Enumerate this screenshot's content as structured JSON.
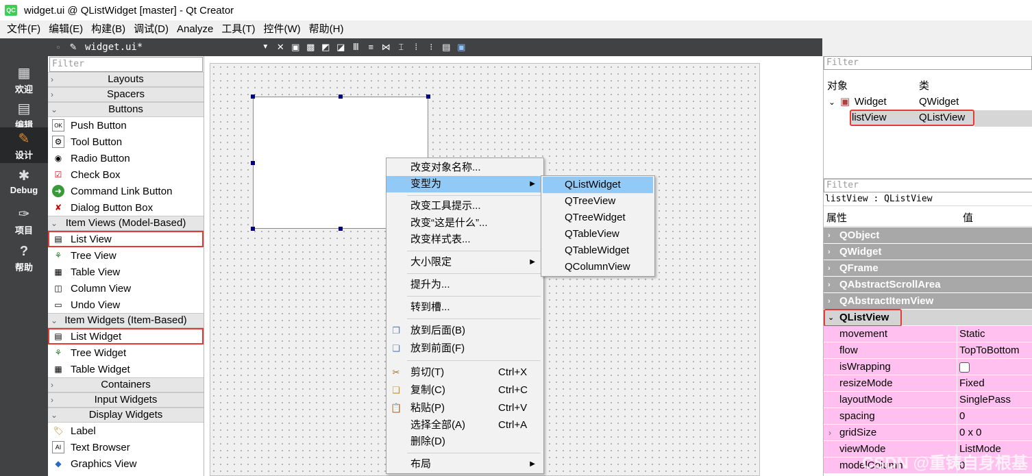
{
  "window": {
    "title": "widget.ui @ QListWidget [master] - Qt Creator",
    "app_icon_label": "QC"
  },
  "menubar": [
    "文件(F)",
    "编辑(E)",
    "构建(B)",
    "调试(D)",
    "Analyze",
    "工具(T)",
    "控件(W)",
    "帮助(H)"
  ],
  "modes": [
    "欢迎",
    "编辑",
    "设计",
    "Debug",
    "项目",
    "帮助"
  ],
  "document": {
    "name": "widget.ui*"
  },
  "widgetbox": {
    "filter_placeholder": "Filter",
    "categories": {
      "layouts": "Layouts",
      "spacers": "Spacers",
      "buttons": "Buttons",
      "item_views": "Item Views (Model-Based)",
      "item_widgets": "Item Widgets (Item-Based)",
      "containers": "Containers",
      "input_widgets": "Input Widgets",
      "display_widgets": "Display Widgets"
    },
    "buttons_items": [
      "Push Button",
      "Tool Button",
      "Radio Button",
      "Check Box",
      "Command Link Button",
      "Dialog Button Box"
    ],
    "item_views_items": [
      "List View",
      "Tree View",
      "Table View",
      "Column View",
      "Undo View"
    ],
    "item_widgets_items": [
      "List Widget",
      "Tree Widget",
      "Table Widget"
    ],
    "display_items": [
      "Label",
      "Text Browser",
      "Graphics View"
    ]
  },
  "context_menu": {
    "items": [
      {
        "label": "改变对象名称..."
      },
      {
        "label": "变型为",
        "submenu": true
      },
      {
        "label": "改变工具提示..."
      },
      {
        "label": "改变“这是什么”..."
      },
      {
        "label": "改变样式表..."
      },
      {
        "label": "大小限定",
        "submenu": true
      },
      {
        "label": "提升为..."
      },
      {
        "label": "转到槽..."
      },
      {
        "label": "放到后面(B)"
      },
      {
        "label": "放到前面(F)"
      },
      {
        "label": "剪切(T)",
        "shortcut": "Ctrl+X"
      },
      {
        "label": "复制(C)",
        "shortcut": "Ctrl+C"
      },
      {
        "label": "粘贴(P)",
        "shortcut": "Ctrl+V"
      },
      {
        "label": "选择全部(A)",
        "shortcut": "Ctrl+A"
      },
      {
        "label": "删除(D)"
      },
      {
        "label": "布局",
        "submenu": true
      }
    ]
  },
  "submenu": {
    "items": [
      "QListWidget",
      "QTreeView",
      "QTreeWidget",
      "QTableView",
      "QTableWidget",
      "QColumnView"
    ]
  },
  "object_inspector": {
    "filter_placeholder": "Filter",
    "col_object": "对象",
    "col_class": "类",
    "rows": [
      {
        "object": "Widget",
        "class": "QWidget"
      },
      {
        "object": "listView",
        "class": "QListView"
      }
    ]
  },
  "property_editor": {
    "filter_placeholder": "Filter",
    "object_label": "listView : QListView",
    "col_property": "属性",
    "col_value": "值",
    "groups": [
      "QObject",
      "QWidget",
      "QFrame",
      "QAbstractScrollArea",
      "QAbstractItemView",
      "QListView"
    ],
    "properties": [
      {
        "name": "movement",
        "value": "Static"
      },
      {
        "name": "flow",
        "value": "TopToBottom"
      },
      {
        "name": "isWrapping",
        "value": ""
      },
      {
        "name": "resizeMode",
        "value": "Fixed"
      },
      {
        "name": "layoutMode",
        "value": "SinglePass"
      },
      {
        "name": "spacing",
        "value": "0"
      },
      {
        "name": "gridSize",
        "value": "0 x 0"
      },
      {
        "name": "viewMode",
        "value": "ListMode"
      },
      {
        "name": "modelColumn",
        "value": "0"
      }
    ]
  },
  "watermark": "CSDN @重铸自身根基"
}
